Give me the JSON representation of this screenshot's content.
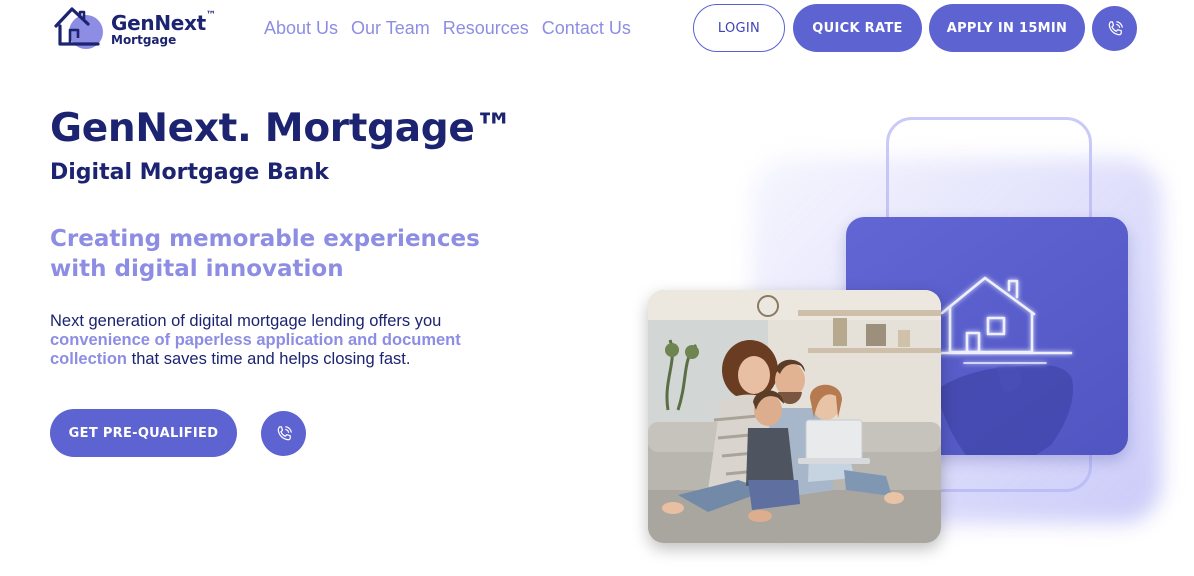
{
  "brand": {
    "name": "GenNext",
    "trademark": "™",
    "sub": "Mortgage"
  },
  "nav": {
    "items": [
      {
        "label": "About Us"
      },
      {
        "label": "Our Team"
      },
      {
        "label": "Resources"
      },
      {
        "label": "Contact Us"
      }
    ]
  },
  "header_actions": {
    "login_label": "LOGIN",
    "quick_rate_label": "QUICK RATE",
    "apply_label": "APPLY IN 15MIN",
    "phone_icon": "phone-icon"
  },
  "hero": {
    "title": "GenNext. Mortgage™",
    "subtitle": "Digital Mortgage Bank",
    "tagline": "Creating memorable experiences with digital innovation",
    "description_start": "Next generation of digital mortgage lending offers you",
    "description_highlight": "convenience of paperless application and document collection",
    "description_end": "that saves time and helps closing fast.",
    "cta_label": "GET PRE-QUALIFIED",
    "phone_icon": "phone-icon"
  },
  "visual": {
    "house_icon": "house-icon",
    "photo": "family-on-couch-photo"
  },
  "colors": {
    "primary": "#5d63d0",
    "navy": "#1c2370",
    "lavender": "#8d8de3",
    "white": "#ffffff"
  }
}
